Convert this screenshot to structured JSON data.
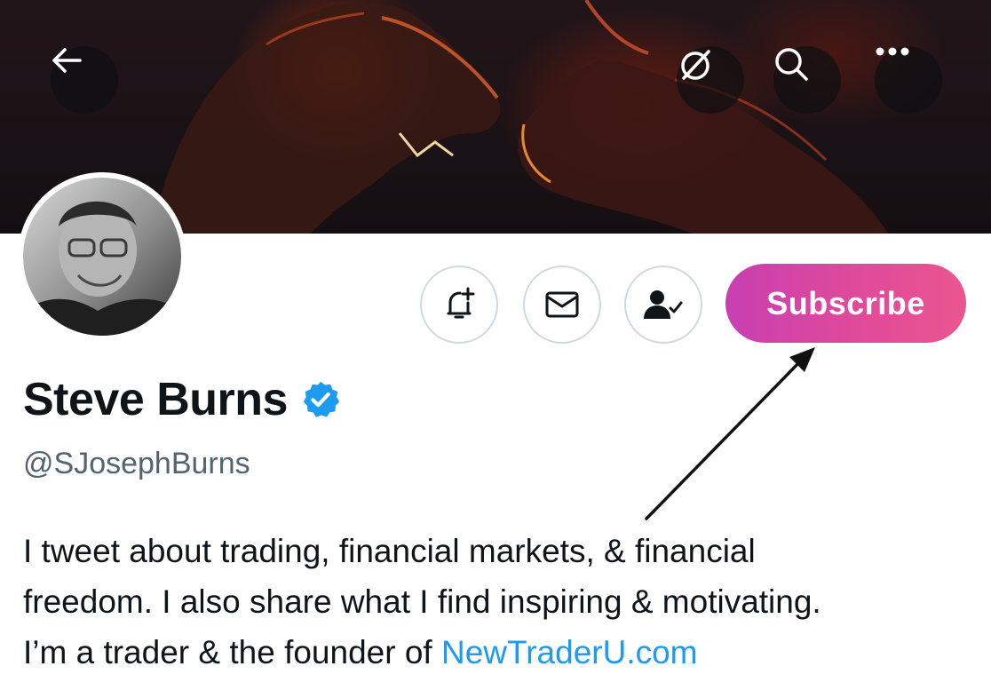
{
  "header": {
    "back_icon": "arrow-left-icon",
    "grok_icon": "slashed-circle-icon",
    "search_icon": "search-icon",
    "more_icon": "more-horizontal-icon"
  },
  "actions": {
    "notify_icon": "bell-plus-icon",
    "message_icon": "envelope-icon",
    "following_icon": "person-check-icon",
    "subscribe_label": "Subscribe"
  },
  "profile": {
    "name": "Steve Burns",
    "verified": true,
    "handle": "@SJosephBurns",
    "bio_line1": "I tweet about trading, financial markets, & financial",
    "bio_line2": "freedom. I also share what I find inspiring & motivating.",
    "bio_line3_prefix": "I’m a trader & the founder of ",
    "bio_link": "NewTraderU.com"
  },
  "colors": {
    "subscribe_gradient_start": "#c83fb2",
    "subscribe_gradient_end": "#ea5590",
    "verified_blue": "#1d9bf0",
    "link_blue": "#1d9bf0",
    "handle_gray": "#536471"
  }
}
